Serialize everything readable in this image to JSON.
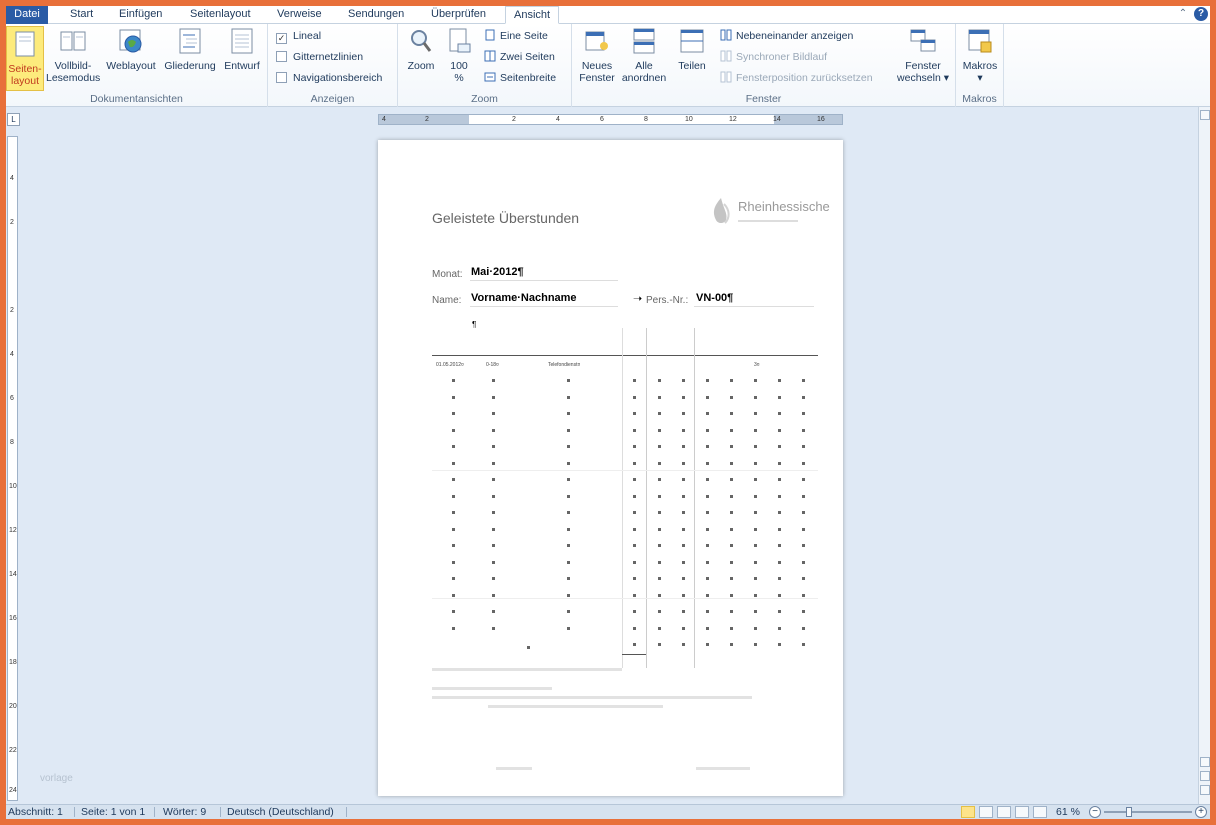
{
  "tabs": [
    {
      "label": "Datei"
    },
    {
      "label": "Start"
    },
    {
      "label": "Einfügen"
    },
    {
      "label": "Seitenlayout"
    },
    {
      "label": "Verweise"
    },
    {
      "label": "Sendungen"
    },
    {
      "label": "Überprüfen"
    },
    {
      "label": "Ansicht"
    }
  ],
  "ribbon": {
    "doc_views": {
      "label": "Dokumentansichten",
      "seitenlayout": "Seiten-\nlayout",
      "vollbild": "Vollbild-\nLesemodus",
      "weblayout": "Weblayout",
      "gliederung": "Gliederung",
      "entwurf": "Entwurf"
    },
    "anzeigen": {
      "label": "Anzeigen",
      "lineal": "Lineal",
      "gitternetz": "Gitternetzlinien",
      "navigation": "Navigationsbereich",
      "lineal_checked": "✓"
    },
    "zoom": {
      "label": "Zoom",
      "zoom": "Zoom",
      "hundert": "100\n%",
      "eine_seite": "Eine Seite",
      "zwei_seiten": "Zwei Seiten",
      "seitenbreite": "Seitenbreite"
    },
    "fenster": {
      "label": "Fenster",
      "neues": "Neues\nFenster",
      "alle": "Alle\nanordnen",
      "teilen": "Teilen",
      "nebeneinander": "Nebeneinander anzeigen",
      "synchron": "Synchroner Bildlauf",
      "fensterpos": "Fensterposition zurücksetzen",
      "wechseln": "Fenster\nwechseln ▾"
    },
    "makros": {
      "label": "Makros",
      "makros": "Makros\n▾"
    }
  },
  "ruler": {
    "h_labels": [
      "4",
      "2",
      "2",
      "4",
      "6",
      "8",
      "10",
      "12",
      "14",
      "16"
    ],
    "v_labels": [
      "4",
      "2",
      "2",
      "4",
      "6",
      "8",
      "10",
      "12",
      "14",
      "16",
      "18",
      "20",
      "22",
      "24"
    ]
  },
  "document": {
    "title": "Geleistete Überstunden",
    "logo_name": "Rheinhessische",
    "monat_label": "Monat:",
    "monat_value": "Mai·2012¶",
    "name_label": "Name:",
    "name_value": "Vorname·Nachname",
    "arrow": "➝",
    "persnr_label": "Pers.-Nr.:",
    "persnr_value": "VN-00¶",
    "pilcrow": "¶",
    "first_row": {
      "date": "01.05.2012¤",
      "time": "0-18¤",
      "desc": "Telefondienst¤",
      "extra": "3¤"
    }
  },
  "watermark": "vorlage",
  "statusbar": {
    "abschnitt": "Abschnitt: 1",
    "seite": "Seite: 1 von 1",
    "woerter": "Wörter: 9",
    "sprache": "Deutsch (Deutschland)",
    "zoom": "61 %"
  },
  "colors": {
    "accent": "#2a5ba5",
    "frame": "#e8703a",
    "workspace": "#dfe9f5"
  }
}
